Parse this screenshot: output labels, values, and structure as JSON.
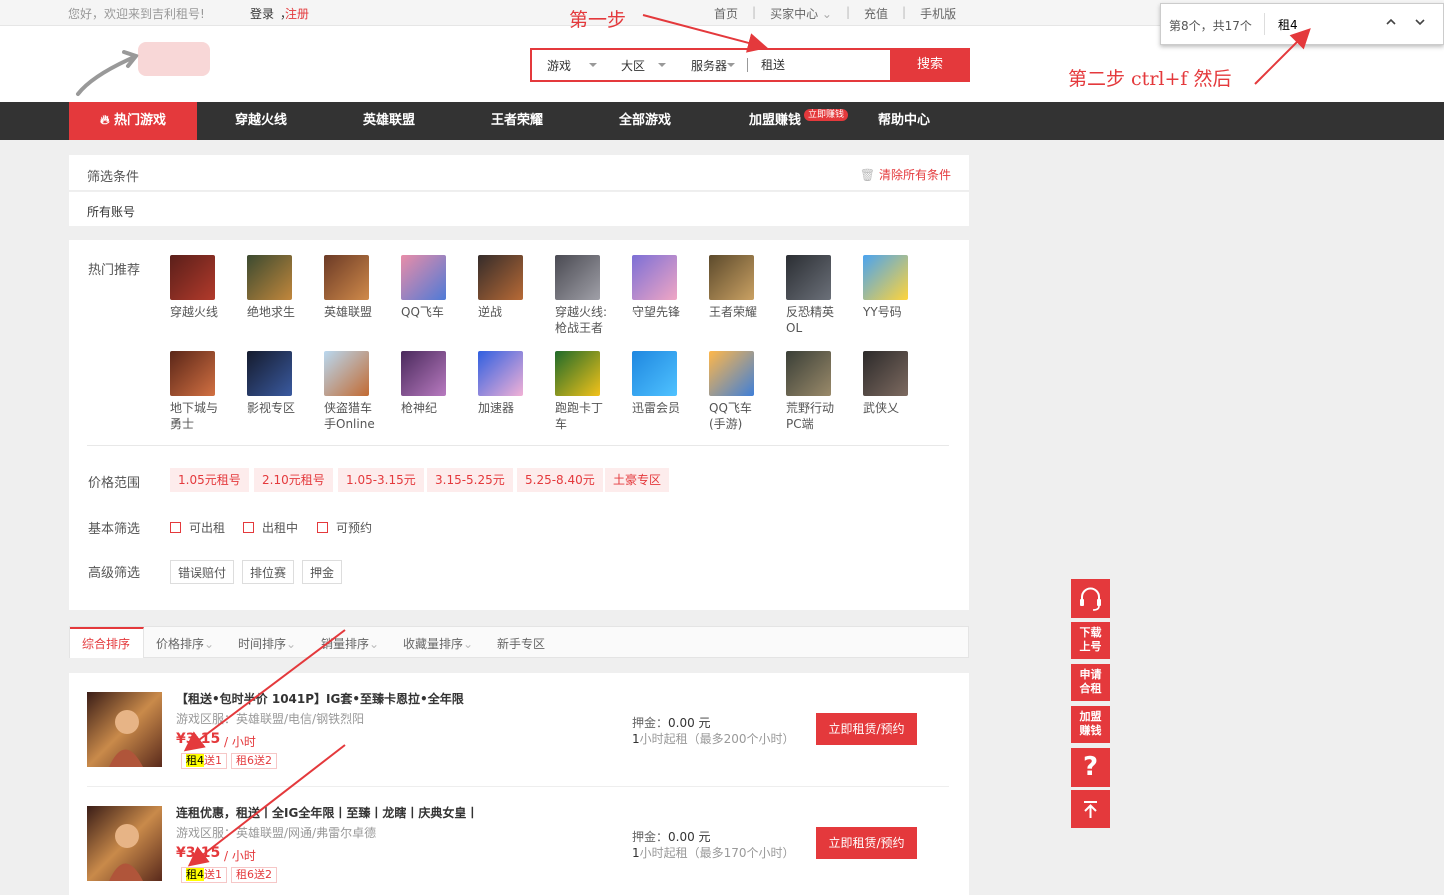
{
  "topbar": {
    "welcome": "您好，欢迎来到吉利租号!",
    "login": "登录",
    "sep": "，",
    "register": "注册",
    "links": [
      "首页",
      "买家中心",
      "充值",
      "手机版"
    ]
  },
  "find": {
    "count": "第8个，共17个",
    "query": "租4",
    "up_icon": "chevron-up-icon",
    "down_icon": "chevron-down-icon"
  },
  "search": {
    "game": "游戏",
    "region": "大区",
    "server": "服务器",
    "keyword": "租送",
    "button": "搜索"
  },
  "nav": {
    "items": [
      "热门游戏",
      "穿越火线",
      "英雄联盟",
      "王者荣耀",
      "全部游戏",
      "加盟赚钱",
      "帮助中心"
    ],
    "badge": "立即赚钱"
  },
  "filter": {
    "title": "筛选条件",
    "clear": "清除所有条件",
    "all": "所有账号"
  },
  "hot": {
    "label": "热门推荐",
    "row1": [
      "穿越火线",
      "绝地求生",
      "英雄联盟",
      "QQ飞车",
      "逆战",
      "穿越火线:\n枪战王者",
      "守望先锋",
      "王者荣耀",
      "反恐精英\nOL",
      "YY号码"
    ],
    "row2": [
      "地下城与\n勇士",
      "影视专区",
      "侠盗猎车\n手Online",
      "枪神纪",
      "加速器",
      "跑跑卡丁\n车",
      "迅雷会员",
      "QQ飞车\n(手游)",
      "荒野行动\nPC端",
      "武侠乂"
    ]
  },
  "price": {
    "label": "价格范围",
    "tags": [
      "1.05元租号",
      "2.10元租号",
      "1.05-3.15元",
      "3.15-5.25元",
      "5.25-8.40元",
      "土豪专区"
    ]
  },
  "basic": {
    "label": "基本筛选",
    "opts": [
      "可出租",
      "出租中",
      "可预约"
    ]
  },
  "adv": {
    "label": "高级筛选",
    "opts": [
      "错误赔付",
      "排位赛",
      "押金"
    ]
  },
  "sort": [
    "综合排序",
    "价格排序",
    "时间排序",
    "销量排序",
    "收藏量排序",
    "新手专区"
  ],
  "accounts": [
    {
      "title": "【租送•包时半价 1041P】IG套•至臻卡恩拉•全年限",
      "area": "游戏区服：英雄联盟/电信/钢铁烈阳",
      "price": "¥3.15",
      "unit": "/ 小时",
      "tag1a": "租4",
      "tag1b": "送1",
      "tag2": "租6送2",
      "deposit_label": "押金：",
      "deposit": "0.00 元",
      "min_a": "1",
      "min_b": "小时起租（最多200个小时）",
      "rent": "立即租赁/预约"
    },
    {
      "title": "连租优惠，租送丨全IG全年限丨至臻丨龙瞎丨庆典女皇丨",
      "area": "游戏区服：英雄联盟/网通/弗雷尔卓德",
      "price": "¥3.15",
      "unit": "/ 小时",
      "tag1a": "租4",
      "tag1b": "送1",
      "tag2": "租6送2",
      "deposit_label": "押金：",
      "deposit": "0.00 元",
      "min_a": "1",
      "min_b": "小时起租（最多170个小时）",
      "rent": "立即租赁/预约"
    }
  ],
  "side": [
    "下载\n上号",
    "申请\n合租",
    "加盟\n赚钱"
  ],
  "annotations": {
    "step1": "第一步",
    "step2": "第二步 ctrl+f 然后"
  },
  "colors": {
    "accent": "#e4393c",
    "nav_bg": "#333333",
    "highlight": "#ffff00"
  }
}
